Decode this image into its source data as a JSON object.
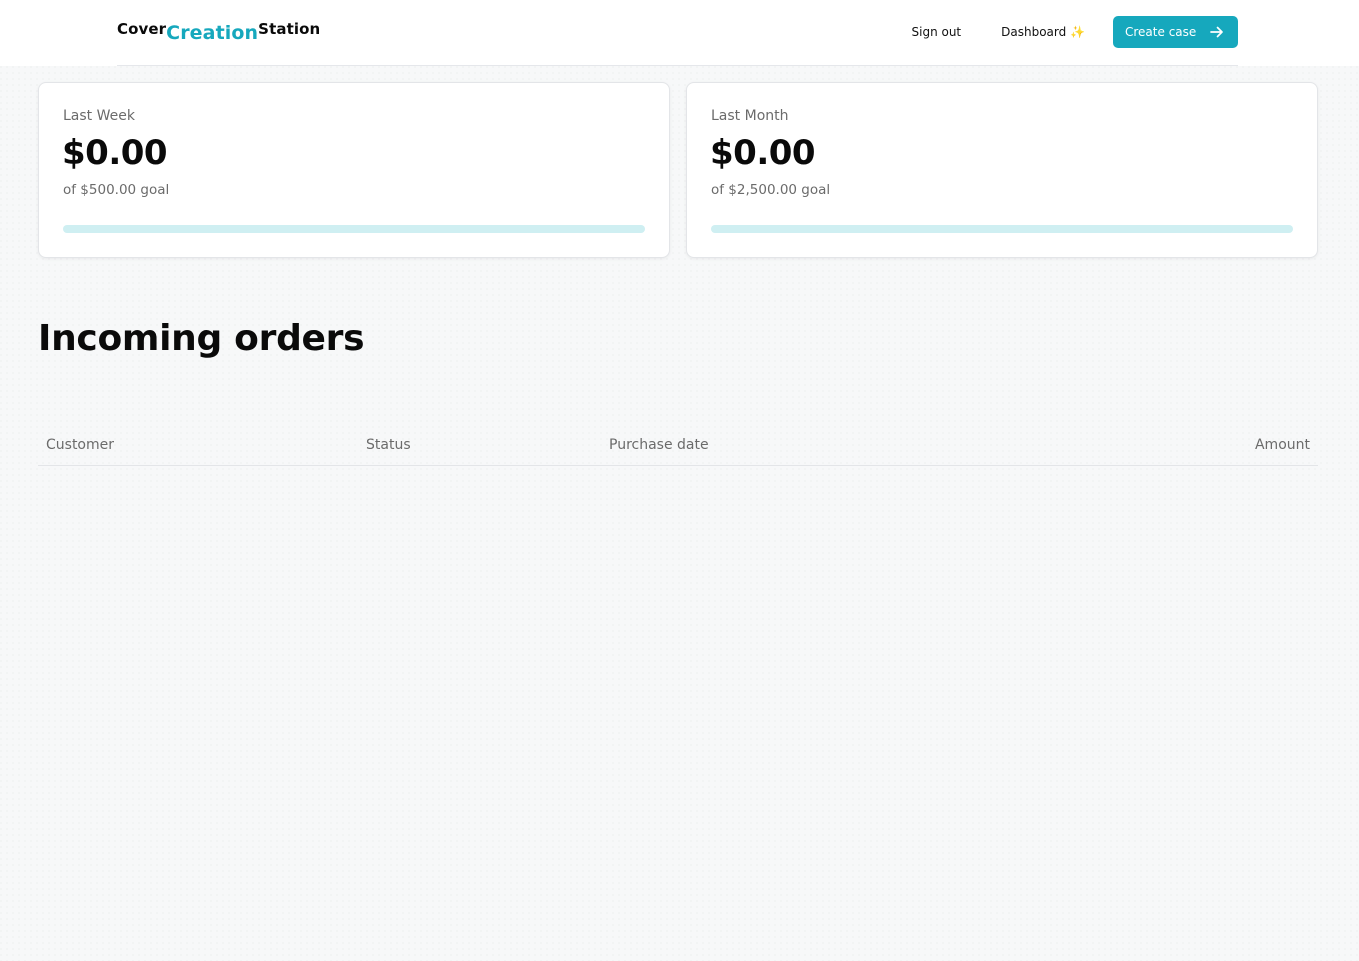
{
  "header": {
    "logo": {
      "part1": "Cover",
      "part2": "Creation",
      "part3": "Station"
    },
    "nav": {
      "sign_out": "Sign out",
      "dashboard": "Dashboard ✨",
      "create_case": "Create case"
    }
  },
  "stats": [
    {
      "label": "Last Week",
      "value": "$0.00",
      "goal": "of $500.00 goal",
      "progress": 0
    },
    {
      "label": "Last Month",
      "value": "$0.00",
      "goal": "of $2,500.00 goal",
      "progress": 0
    }
  ],
  "orders": {
    "title": "Incoming orders",
    "columns": [
      "Customer",
      "Status",
      "Purchase date",
      "Amount"
    ],
    "rows": []
  },
  "colors": {
    "accent": "#16a8bd",
    "progress_track": "#cfeff2",
    "muted_text": "#6b6b6b"
  },
  "icons": {
    "create_case": "arrow-right-icon"
  }
}
